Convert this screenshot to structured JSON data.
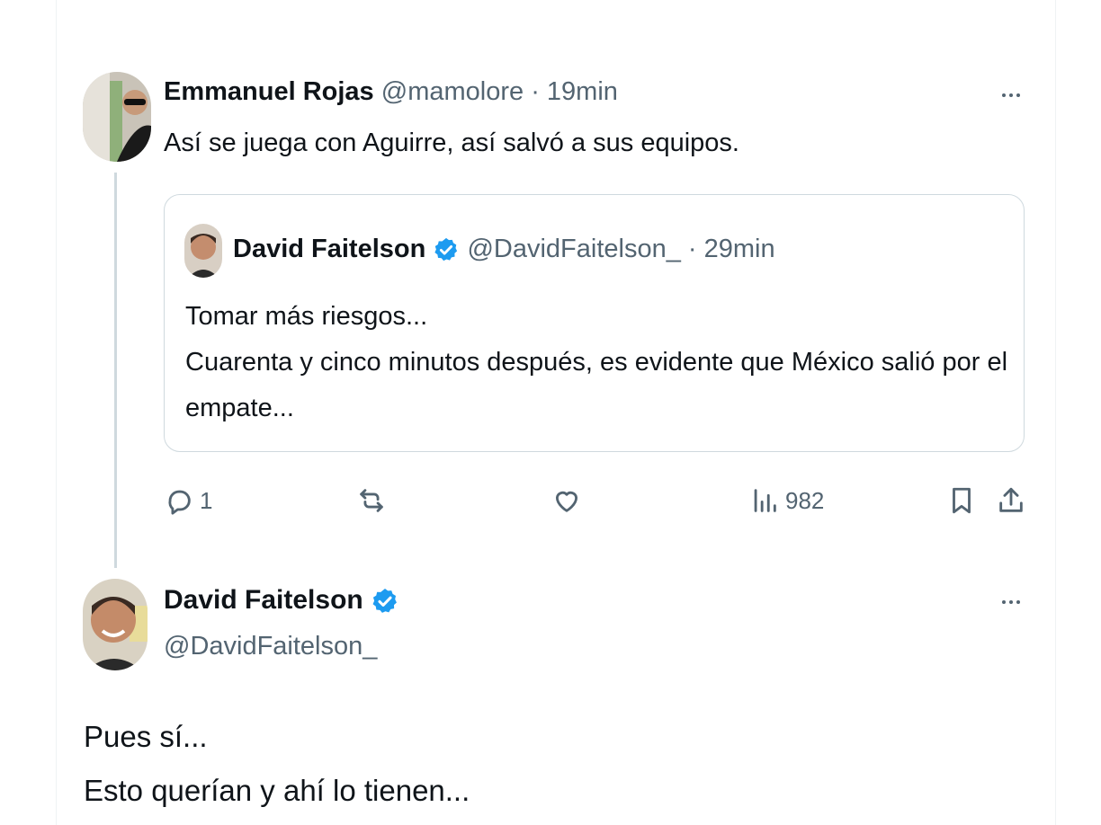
{
  "reply_tweet": {
    "author_name": "Emmanuel Rojas",
    "handle": "@mamolore",
    "separator": "·",
    "time": "19min",
    "text": "Así se juega con Aguirre, así salvó a sus equipos."
  },
  "quoted_tweet": {
    "author_name": "David Faitelson",
    "verified": true,
    "handle": "@DavidFaitelson_",
    "separator": "·",
    "time": "29min",
    "line1": "Tomar más riesgos...",
    "line2": "Cuarenta y cinco minutos después, es evidente que México salió por el",
    "line3": "empate..."
  },
  "actions": {
    "reply_icon": "reply-icon",
    "reply_count": "1",
    "retweet_icon": "retweet-icon",
    "like_icon": "heart-icon",
    "views_icon": "views-icon",
    "views_count": "982",
    "bookmark_icon": "bookmark-icon",
    "share_icon": "share-icon"
  },
  "main_tweet": {
    "author_name": "David Faitelson",
    "verified": true,
    "handle": "@DavidFaitelson_",
    "line1": "Pues sí...",
    "line2": "Esto querían y ahí lo tienen..."
  },
  "colors": {
    "verified_blue": "#1d9bf0",
    "text": "#0f1419",
    "muted": "#536471",
    "border": "#cfd9de"
  }
}
